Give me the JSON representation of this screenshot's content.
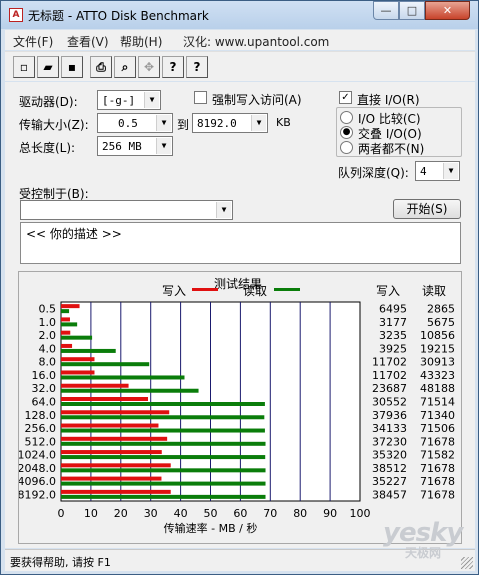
{
  "window": {
    "title": "无标题 - ATTO Disk Benchmark",
    "app_icon": "A",
    "controls": {
      "min": "—",
      "max": "□",
      "close": "✕"
    }
  },
  "menu": {
    "items": [
      {
        "label": "文件(F)"
      },
      {
        "label": "查看(V)"
      },
      {
        "label": "帮助(H)"
      },
      {
        "label": "汉化: www.upantool.com"
      }
    ]
  },
  "toolbar": {
    "buttons": [
      {
        "name": "new-icon",
        "glyph": "▫"
      },
      {
        "name": "open-icon",
        "glyph": "▰"
      },
      {
        "name": "save-icon",
        "glyph": "▪"
      },
      {
        "name": "print-icon",
        "glyph": "⎙"
      },
      {
        "name": "print-preview-icon",
        "glyph": "⌕"
      },
      {
        "name": "move-icon",
        "glyph": "✥"
      },
      {
        "name": "help-icon",
        "glyph": "?"
      },
      {
        "name": "context-help-icon",
        "glyph": "?"
      }
    ]
  },
  "settings": {
    "drive_label": "驱动器(D):",
    "drive_value": "[-g-]",
    "transfer_label": "传输大小(Z):",
    "transfer_from": "0.5",
    "transfer_to_label": "到",
    "transfer_to": "8192.0",
    "transfer_unit": "KB",
    "total_label": "总长度(L):",
    "total_value": "256 MB",
    "force_write_label": "强制写入访问(A)",
    "force_write_checked": false,
    "direct_io_label": "直接 I/O(R)",
    "direct_io_checked": true,
    "radio_options": [
      {
        "label": "I/O 比较(C)",
        "selected": false
      },
      {
        "label": "交叠 I/O(O)",
        "selected": true
      },
      {
        "label": "两者都不(N)",
        "selected": false
      }
    ],
    "queue_label": "队列深度(Q):",
    "queue_value": "4",
    "controlled_by_label": "受控制于(B):",
    "controlled_by_value": "",
    "start_button": "开始(S)",
    "description": "<<  你的描述  >>"
  },
  "results": {
    "title": "测试结果",
    "legend_write": "写入",
    "legend_read": "读取",
    "col_write": "写入",
    "col_read": "读取",
    "write_color": "#e01010",
    "read_color": "#0a7d0a"
  },
  "chart_data": {
    "type": "bar",
    "orientation": "horizontal",
    "title": "测试结果",
    "xlabel": "传输速率 - MB / 秒",
    "xlim": [
      0,
      100
    ],
    "x_ticks": [
      "0",
      "10",
      "20",
      "30",
      "40",
      "50",
      "60",
      "70",
      "80",
      "90",
      "100"
    ],
    "categories": [
      "0.5",
      "1.0",
      "2.0",
      "4.0",
      "8.0",
      "16.0",
      "32.0",
      "64.0",
      "128.0",
      "256.0",
      "512.0",
      "1024.0",
      "2048.0",
      "4096.0",
      "8192.0"
    ],
    "series": [
      {
        "name": "写入",
        "values": [
          6.2,
          3.0,
          3.1,
          3.7,
          11.2,
          11.2,
          22.6,
          29.1,
          36.2,
          32.6,
          35.5,
          33.7,
          36.7,
          33.6,
          36.7
        ]
      },
      {
        "name": "读取",
        "values": [
          2.7,
          5.4,
          10.4,
          18.3,
          29.5,
          41.3,
          46.0,
          68.2,
          68.0,
          68.2,
          68.4,
          68.3,
          68.4,
          68.4,
          68.4
        ]
      }
    ],
    "write_table": [
      "6495",
      "3177",
      "3235",
      "3925",
      "11702",
      "11702",
      "23687",
      "30552",
      "37936",
      "34133",
      "37230",
      "35320",
      "38512",
      "35227",
      "38457"
    ],
    "read_table": [
      "2865",
      "5675",
      "10856",
      "19215",
      "30913",
      "43323",
      "48188",
      "71514",
      "71340",
      "71506",
      "71678",
      "71582",
      "71678",
      "71678",
      "71678"
    ],
    "grid": true,
    "legend": "top"
  },
  "status": {
    "text": "要获得帮助, 请按 F1"
  },
  "watermark": {
    "logo": "yesky",
    "sub": "天极网"
  }
}
